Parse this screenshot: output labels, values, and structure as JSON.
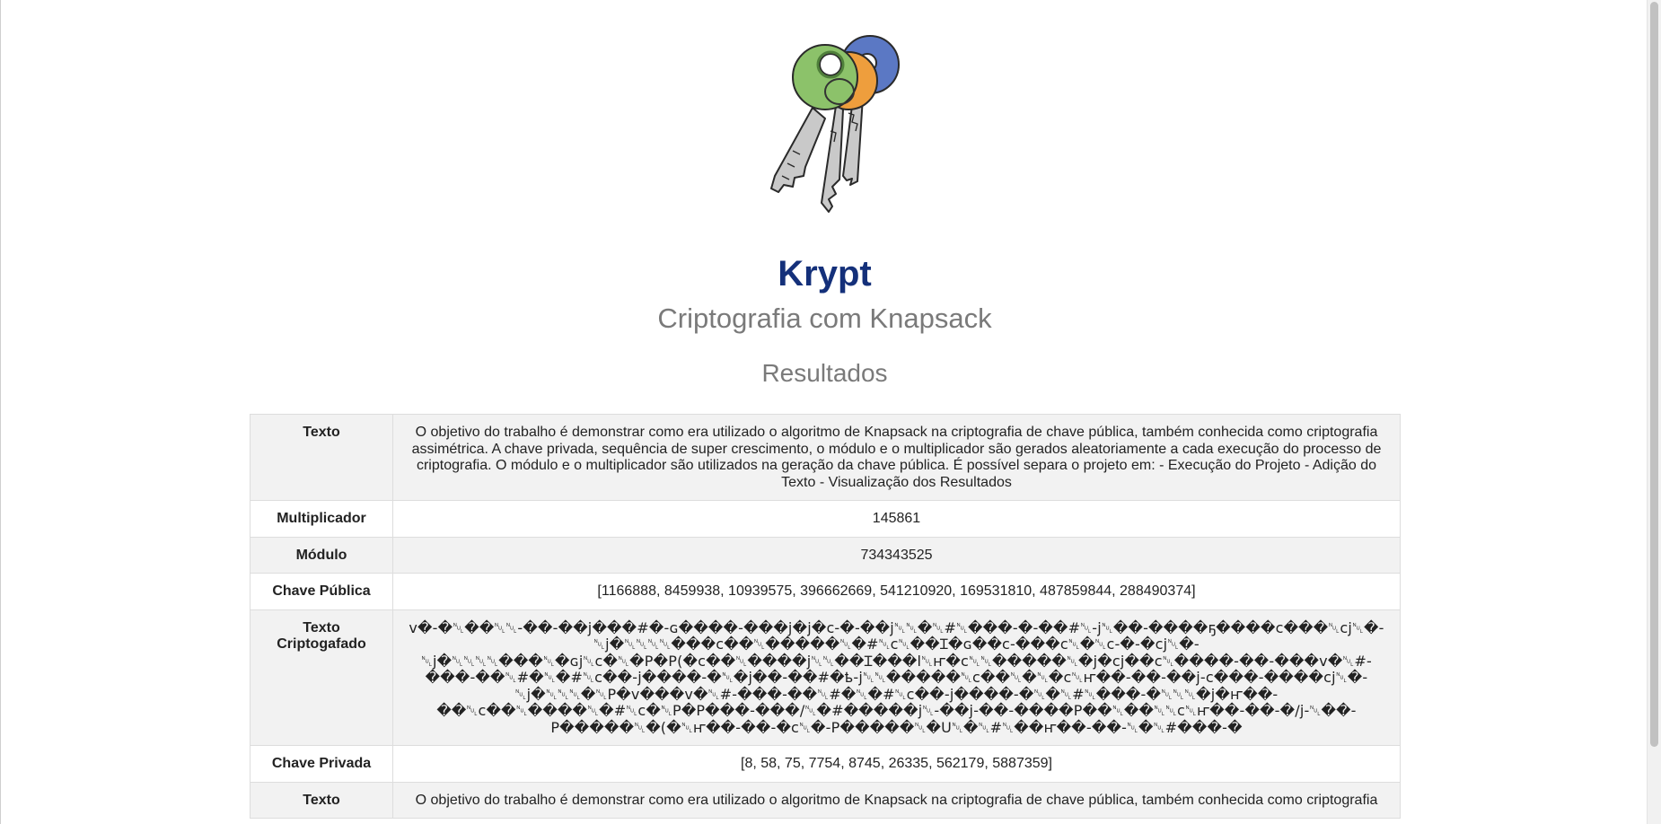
{
  "header": {
    "logo_icon": "keys-icon",
    "title": "Krypt",
    "subtitle": "Criptografia com Knapsack",
    "section_title": "Resultados"
  },
  "results": {
    "rows": [
      {
        "label": "Texto",
        "value": "O objetivo do trabalho é demonstrar como era utilizado o algoritmo de Knapsack na criptografia de chave pública, também conhecida como criptografia assimétrica. A chave privada, sequência de super crescimento, o módulo e o multiplicador são gerados aleatoriamente a cada execução do processo de criptografia. O módulo e o multiplicador são utilizados na geração da chave pública. É possível separa o projeto em: - Execução do Projeto - Adição do Texto - Visualização dos Resultados"
      },
      {
        "label": "Multiplicador",
        "value": "145861"
      },
      {
        "label": "Módulo",
        "value": "734343525"
      },
      {
        "label": "Chave Pública",
        "value": "[1166888, 8459938, 10939575, 396662669, 541210920, 169531810, 487859844, 288490374]"
      },
      {
        "label": "Texto Criptogafado",
        "value": "v�-�␀��␀␀-��-��j���#�-ɢ����-���j�j�c-�-��j␀␀�␀#␀���-�-��#␀-j␀��-����ҕ����c���␀cj␀�-␀j�␀␀␀␀���c��␀�����␀�#␀c␀��Ɪ�ɢ��c-���c␀�␀c-�-�cj␀�-␀j�␀␀␀␀���␀�ɢj␀c�␀�P�P(�c��␀����j␀␀��Ɪ���l␀ҥ�c␀␀�����␀�j�cj��c␀����-��-���v�␀#-���-��␀#�␀�#␀c��-j����-�␀�j��-��#�ҍ-j␀␀�����␀c��␀�␀�c␀ҥ��-��-��j-c���-����cj␀�-␀j�␀␀␀�␀P�v���v�␀#-���-��␀#�␀�#␀c��-j����-�␀�␀#␀���-�␀␀␀�j�ҥ��-��␀c��␀����␀�#␀c�␀P�P���-���/␀�#�����j␀-��j-��-����P��␀��␀␀c␀ҥ��-��-�/j-␀��-P�����␀�(�␀ҥ��-��-�c␀�-P�����␀�U␀�␀#␀��ҥ��-��-␀�␀#���-�"
      },
      {
        "label": "Chave Privada",
        "value": "[8, 58, 75, 7754, 8745, 26335, 562179, 5887359]"
      },
      {
        "label": "Texto",
        "value": "O objetivo do trabalho é demonstrar como era utilizado o algoritmo de Knapsack na criptografia de chave pública, também conhecida como criptografia"
      }
    ]
  }
}
